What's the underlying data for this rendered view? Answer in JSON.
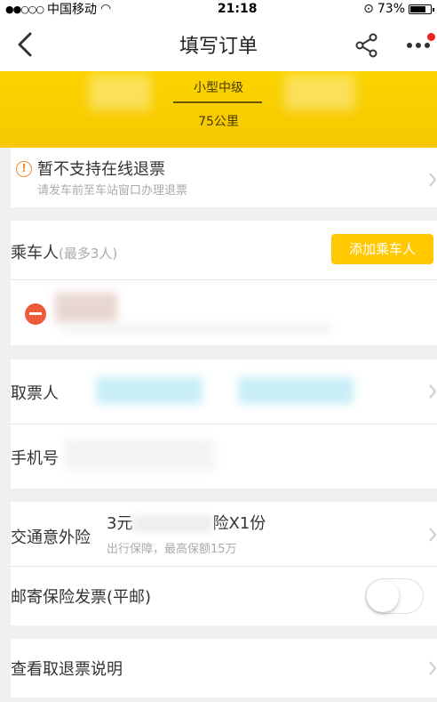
{
  "status_bar": {
    "carrier": "中国移动",
    "time": "21:18",
    "battery": "73%"
  },
  "nav": {
    "title": "填写订单"
  },
  "banner": {
    "car_type": "小型中级",
    "distance": "75公里"
  },
  "refund": {
    "title": "暂不支持在线退票",
    "subtitle": "请发车前至车站窗口办理退票"
  },
  "passenger": {
    "label": "乘车人",
    "limit": "(最多3人)",
    "add_button": "添加乘车人"
  },
  "ticket_collector": {
    "label": "取票人"
  },
  "phone": {
    "label": "手机号"
  },
  "insurance": {
    "label": "交通意外险",
    "price_prefix": "3元",
    "price_suffix": "险X1份",
    "subtitle": "出行保障，最高保额15万"
  },
  "invoice": {
    "label": "邮寄保险发票(平邮)",
    "enabled": false
  },
  "refund_policy": {
    "label": "查看取退票说明"
  },
  "colors": {
    "accent": "#ffc800",
    "warning": "#f08a2c",
    "delete": "#ef5a3a"
  }
}
